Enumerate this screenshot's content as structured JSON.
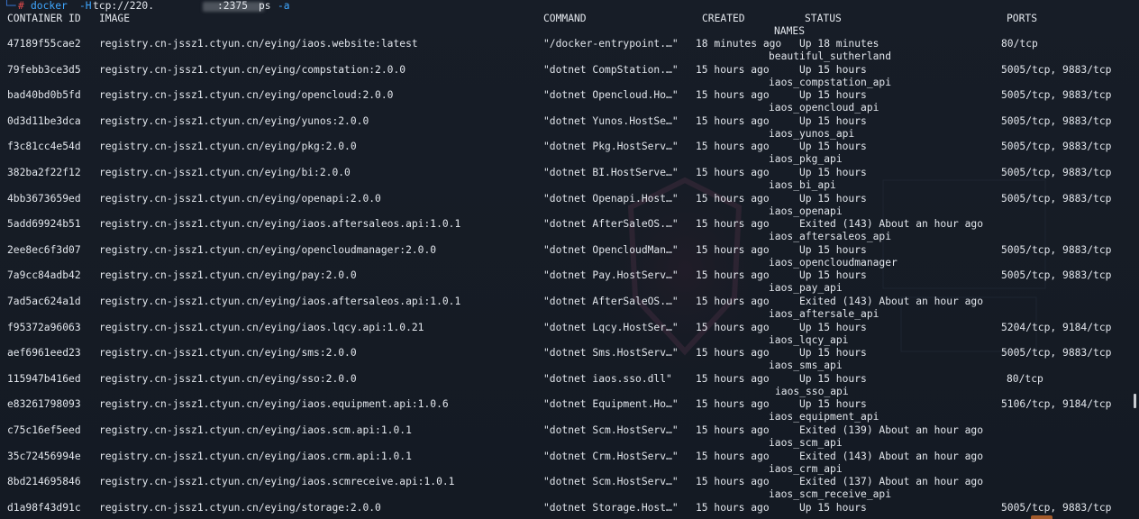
{
  "prompt": {
    "decor": "└─",
    "hash": "#",
    "command": "docker",
    "flag_host": "-H",
    "host_prefix": "tcp://220.",
    "host_suffix": ":2375",
    "subcommand": "ps",
    "flag_all": "-a"
  },
  "headers": {
    "container_id": "CONTAINER ID",
    "image": "IMAGE",
    "command": "COMMAND",
    "created": "CREATED",
    "status": "STATUS",
    "ports": "PORTS",
    "names": "NAMES"
  },
  "rows": [
    {
      "id": "47189f55cae2",
      "image": "registry.cn-jssz1.ctyun.cn/eying/iaos.website:latest",
      "command": "\"/docker-entrypoint.…\"",
      "created": "18 minutes ago",
      "status": "Up 18 minutes",
      "ports": "80/tcp",
      "name": "beautiful_sutherland"
    },
    {
      "id": "79febb3ce3d5",
      "image": "registry.cn-jssz1.ctyun.cn/eying/compstation:2.0.0",
      "command": "\"dotnet CompStation.…\"",
      "created": "15 hours ago",
      "status": "Up 15 hours",
      "ports": "5005/tcp, 9883/tcp",
      "name": "iaos_compstation_api"
    },
    {
      "id": "bad40bd0b5fd",
      "image": "registry.cn-jssz1.ctyun.cn/eying/opencloud:2.0.0",
      "command": "\"dotnet Opencloud.Ho…\"",
      "created": "15 hours ago",
      "status": "Up 15 hours",
      "ports": "5005/tcp, 9883/tcp",
      "name": "iaos_opencloud_api"
    },
    {
      "id": "0d3d11be3dca",
      "image": "registry.cn-jssz1.ctyun.cn/eying/yunos:2.0.0",
      "command": "\"dotnet Yunos.HostSe…\"",
      "created": "15 hours ago",
      "status": "Up 15 hours",
      "ports": "5005/tcp, 9883/tcp",
      "name": "iaos_yunos_api"
    },
    {
      "id": "f3c81cc4e54d",
      "image": "registry.cn-jssz1.ctyun.cn/eying/pkg:2.0.0",
      "command": "\"dotnet Pkg.HostServ…\"",
      "created": "15 hours ago",
      "status": "Up 15 hours",
      "ports": "5005/tcp, 9883/tcp",
      "name": "iaos_pkg_api"
    },
    {
      "id": "382ba2f22f12",
      "image": "registry.cn-jssz1.ctyun.cn/eying/bi:2.0.0",
      "command": "\"dotnet BI.HostServe…\"",
      "created": "15 hours ago",
      "status": "Up 15 hours",
      "ports": "5005/tcp, 9883/tcp",
      "name": "iaos_bi_api"
    },
    {
      "id": "4bb3673659ed",
      "image": "registry.cn-jssz1.ctyun.cn/eying/openapi:2.0.0",
      "command": "\"dotnet Openapi.Host…\"",
      "created": "15 hours ago",
      "status": "Up 15 hours",
      "ports": "5005/tcp, 9883/tcp",
      "name": "iaos_openapi"
    },
    {
      "id": "5add69924b51",
      "image": "registry.cn-jssz1.ctyun.cn/eying/iaos.aftersaleos.api:1.0.1",
      "command": "\"dotnet AfterSaleOS.…\"",
      "created": "15 hours ago",
      "status": "Exited (143) About an hour ago",
      "ports": "",
      "name": "iaos_aftersaleos_api"
    },
    {
      "id": "2ee8ec6f3d07",
      "image": "registry.cn-jssz1.ctyun.cn/eying/opencloudmanager:2.0.0",
      "command": "\"dotnet OpencloudMan…\"",
      "created": "15 hours ago",
      "status": "Up 15 hours",
      "ports": "5005/tcp, 9883/tcp",
      "name": "iaos_opencloudmanager"
    },
    {
      "id": "7a9cc84adb42",
      "image": "registry.cn-jssz1.ctyun.cn/eying/pay:2.0.0",
      "command": "\"dotnet Pay.HostServ…\"",
      "created": "15 hours ago",
      "status": "Up 15 hours",
      "ports": "5005/tcp, 9883/tcp",
      "name": "iaos_pay_api"
    },
    {
      "id": "7ad5ac624a1d",
      "image": "registry.cn-jssz1.ctyun.cn/eying/iaos.aftersaleos.api:1.0.1",
      "command": "\"dotnet AfterSaleOS.…\"",
      "created": "15 hours ago",
      "status": "Exited (143) About an hour ago",
      "ports": "",
      "name": "iaos_aftersale_api"
    },
    {
      "id": "f95372a96063",
      "image": "registry.cn-jssz1.ctyun.cn/eying/iaos.lqcy.api:1.0.21",
      "command": "\"dotnet Lqcy.HostSer…\"",
      "created": "15 hours ago",
      "status": "Up 15 hours",
      "ports": "5204/tcp, 9184/tcp",
      "name": "iaos_lqcy_api"
    },
    {
      "id": "aef6961eed23",
      "image": "registry.cn-jssz1.ctyun.cn/eying/sms:2.0.0",
      "command": "\"dotnet Sms.HostServ…\"",
      "created": "15 hours ago",
      "status": "Up 15 hours",
      "ports": "5005/tcp, 9883/tcp",
      "name": "iaos_sms_api"
    },
    {
      "id": "115947b416ed",
      "image": "registry.cn-jssz1.ctyun.cn/eying/sso:2.0.0",
      "command": "\"dotnet iaos.sso.dll\"",
      "created": "15 hours ago",
      "status": "Up 15 hours",
      "ports": "80/tcp",
      "name": "iaos_sso_api"
    },
    {
      "id": "e83261798093",
      "image": "registry.cn-jssz1.ctyun.cn/eying/iaos.equipment.api:1.0.6",
      "command": "\"dotnet Equipment.Ho…\"",
      "created": "15 hours ago",
      "status": "Up 15 hours",
      "ports": "5106/tcp, 9184/tcp",
      "name": "iaos_equipment_api"
    },
    {
      "id": "c75c16ef5eed",
      "image": "registry.cn-jssz1.ctyun.cn/eying/iaos.scm.api:1.0.1",
      "command": "\"dotnet Scm.HostServ…\"",
      "created": "15 hours ago",
      "status": "Exited (139) About an hour ago",
      "ports": "",
      "name": "iaos_scm_api"
    },
    {
      "id": "35c72456994e",
      "image": "registry.cn-jssz1.ctyun.cn/eying/iaos.crm.api:1.0.1",
      "command": "\"dotnet Crm.HostServ…\"",
      "created": "15 hours ago",
      "status": "Exited (143) About an hour ago",
      "ports": "",
      "name": "iaos_crm_api"
    },
    {
      "id": "8bd214695846",
      "image": "registry.cn-jssz1.ctyun.cn/eying/iaos.scmreceive.api:1.0.1",
      "command": "\"dotnet Scm.HostServ…\"",
      "created": "15 hours ago",
      "status": "Exited (137) About an hour ago",
      "ports": "",
      "name": "iaos_scm_receive_api"
    },
    {
      "id": "d1a98f43d91c",
      "image": "registry.cn-jssz1.ctyun.cn/eying/storage:2.0.0",
      "command": "\"dotnet Storage.Host…\"",
      "created": "15 hours ago",
      "status": "Up 15 hours",
      "ports": "5005/tcp, 9883/tcp",
      "name": ""
    }
  ],
  "colors": {
    "background": "#151b24",
    "text": "#e2e6ec",
    "prompt_command": "#3fa7ff",
    "prompt_hash": "#e24b4b"
  }
}
